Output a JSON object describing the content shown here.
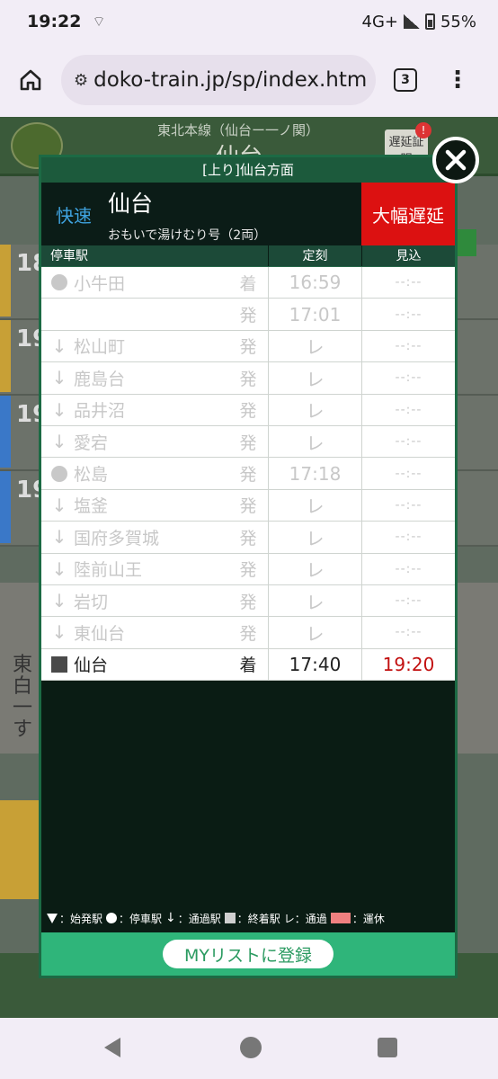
{
  "status_bar": {
    "time": "19:22",
    "network": "4G+",
    "battery": "55%"
  },
  "browser": {
    "url": "doko-train.jp/sp/index.htm",
    "tab_count": "3"
  },
  "background_page": {
    "line_name": "東北本線（仙台ー一ノ関）",
    "station": "仙台",
    "delay_cert": "遅延証明",
    "row_numbers": [
      "18",
      "19",
      "19",
      "19"
    ],
    "notice_lines": [
      "東",
      "白",
      "一",
      "す"
    ]
  },
  "modal": {
    "title": "[上り]仙台方面",
    "train_type": "快速",
    "destination": "仙台",
    "train_name": "おもいで湯けむり号（2両）",
    "status": "大幅遅延",
    "columns": {
      "station": "停車駅",
      "scheduled": "定刻",
      "expected": "見込"
    },
    "rows": [
      {
        "mark": "dot",
        "station": "小牛田",
        "kind": "着",
        "scheduled": "16:59",
        "expected": "--:--"
      },
      {
        "mark": "none",
        "station": "",
        "kind": "発",
        "scheduled": "17:01",
        "expected": "--:--"
      },
      {
        "mark": "arrow",
        "station": "松山町",
        "kind": "発",
        "scheduled": "レ",
        "expected": "--:--"
      },
      {
        "mark": "arrow",
        "station": "鹿島台",
        "kind": "発",
        "scheduled": "レ",
        "expected": "--:--"
      },
      {
        "mark": "arrow",
        "station": "品井沼",
        "kind": "発",
        "scheduled": "レ",
        "expected": "--:--"
      },
      {
        "mark": "arrow",
        "station": "愛宕",
        "kind": "発",
        "scheduled": "レ",
        "expected": "--:--"
      },
      {
        "mark": "dot",
        "station": "松島",
        "kind": "発",
        "scheduled": "17:18",
        "expected": "--:--"
      },
      {
        "mark": "arrow",
        "station": "塩釜",
        "kind": "発",
        "scheduled": "レ",
        "expected": "--:--"
      },
      {
        "mark": "arrow",
        "station": "国府多賀城",
        "kind": "発",
        "scheduled": "レ",
        "expected": "--:--"
      },
      {
        "mark": "arrow",
        "station": "陸前山王",
        "kind": "発",
        "scheduled": "レ",
        "expected": "--:--"
      },
      {
        "mark": "arrow",
        "station": "岩切",
        "kind": "発",
        "scheduled": "レ",
        "expected": "--:--"
      },
      {
        "mark": "arrow",
        "station": "東仙台",
        "kind": "発",
        "scheduled": "レ",
        "expected": "--:--"
      },
      {
        "mark": "square",
        "station": "仙台",
        "kind": "着",
        "scheduled": "17:40",
        "expected": "19:20"
      }
    ],
    "legend": {
      "origin": "：始発駅",
      "stop": "：停車駅",
      "pass": "：通過駅",
      "terminal": "：終着駅",
      "pass_mark": "レ：通過",
      "cancel": "：運休"
    },
    "mylist_button": "MYリストに登録"
  },
  "colors": {
    "status_red": "#dc1111",
    "expected_red": "#c21010",
    "type_blue": "#3fa3e0",
    "footer_green": "#2fb57a"
  }
}
